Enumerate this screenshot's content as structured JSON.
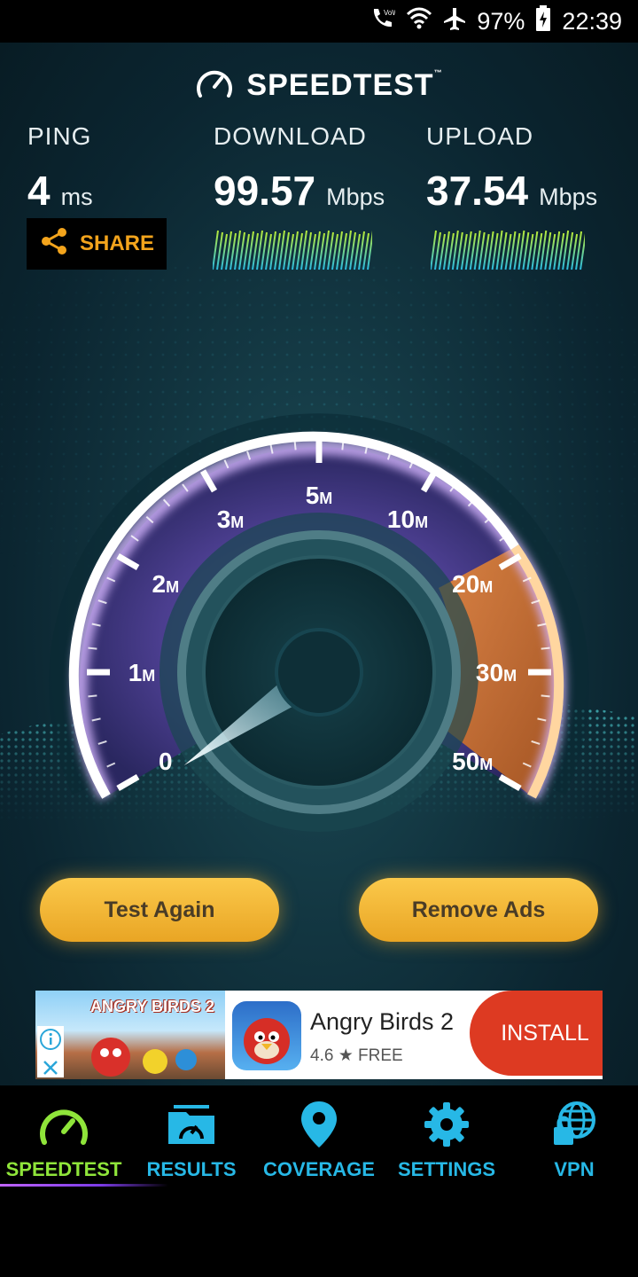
{
  "status_bar": {
    "battery": "97%",
    "time": "22:39"
  },
  "brand": {
    "name": "SPEEDTEST",
    "tm": "™"
  },
  "metrics": {
    "ping": {
      "label": "PING",
      "value": "4",
      "unit": "ms"
    },
    "download": {
      "label": "DOWNLOAD",
      "value": "99.57",
      "unit": "Mbps"
    },
    "upload": {
      "label": "UPLOAD",
      "value": "37.54",
      "unit": "Mbps"
    }
  },
  "share_label": "SHARE",
  "gauge": {
    "ticks": [
      "0",
      "1",
      "2",
      "3",
      "5",
      "10",
      "20",
      "30",
      "50"
    ],
    "unit_suffix": "M",
    "needle_value": 0
  },
  "buttons": {
    "test_again": "Test Again",
    "remove_ads": "Remove Ads"
  },
  "ad": {
    "banner_title": "ANGRY BIRDS 2",
    "app_name": "Angry Birds 2",
    "rating": "4.6",
    "price": "FREE",
    "install_label": "INSTALL"
  },
  "nav": {
    "items": [
      {
        "label": "SPEEDTEST",
        "icon": "speedometer-icon",
        "active": true
      },
      {
        "label": "RESULTS",
        "icon": "results-folder-icon",
        "active": false
      },
      {
        "label": "COVERAGE",
        "icon": "map-pin-icon",
        "active": false
      },
      {
        "label": "SETTINGS",
        "icon": "gear-icon",
        "active": false
      },
      {
        "label": "VPN",
        "icon": "vpn-globe-lock-icon",
        "active": false
      }
    ]
  },
  "colors": {
    "accent_orange": "#f3a41c",
    "nav_blue": "#27b8e6",
    "nav_active_green": "#8fe53a",
    "install_red": "#dd3a22"
  }
}
